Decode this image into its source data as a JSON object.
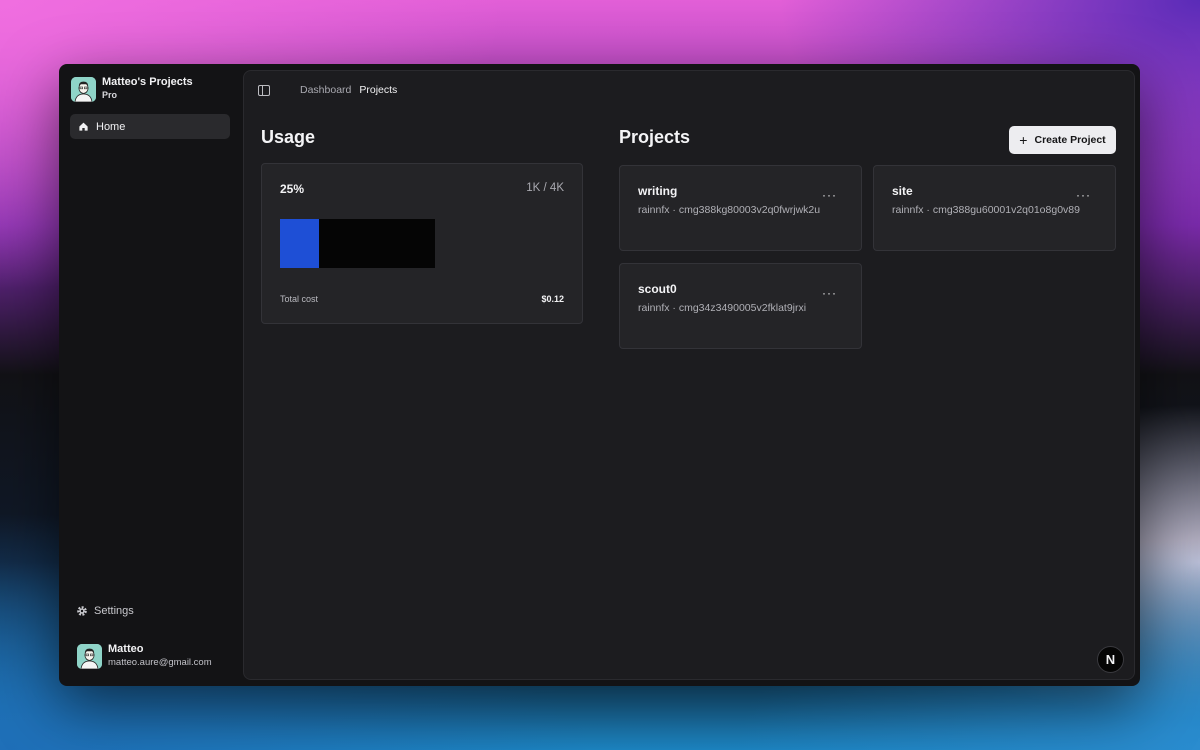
{
  "org": {
    "name": "Matteo's Projects",
    "plan": "Pro"
  },
  "nav": {
    "home": "Home",
    "settings": "Settings"
  },
  "user": {
    "name": "Matteo",
    "email": "matteo.aure@gmail.com"
  },
  "breadcrumb": {
    "parent": "Dashboard",
    "current": "Projects"
  },
  "usage": {
    "heading": "Usage",
    "percent_label": "25%",
    "ratio": "1K / 4K",
    "percent_value": 0.25,
    "cost_label": "Total cost",
    "cost_value": "$0.12",
    "colors": {
      "fill": "#1e4fd6",
      "track": "#050505"
    }
  },
  "projects": {
    "heading": "Projects",
    "create_label": "Create Project",
    "items": [
      {
        "name": "writing",
        "meta": "rainnfx · cmg388kg80003v2q0fwrjwk2u",
        "more": "···"
      },
      {
        "name": "site",
        "meta": "rainnfx · cmg388gu60001v2q01o8g0v89",
        "more": "···"
      },
      {
        "name": "scout0",
        "meta": "rainnfx · cmg34z3490005v2fklat9jrxi",
        "more": "···"
      }
    ]
  },
  "badge": {
    "letter": "N"
  },
  "icons": [
    "home-icon",
    "gear-icon",
    "sidebar-toggle-icon",
    "plus-icon",
    "more-icon",
    "avatar"
  ]
}
